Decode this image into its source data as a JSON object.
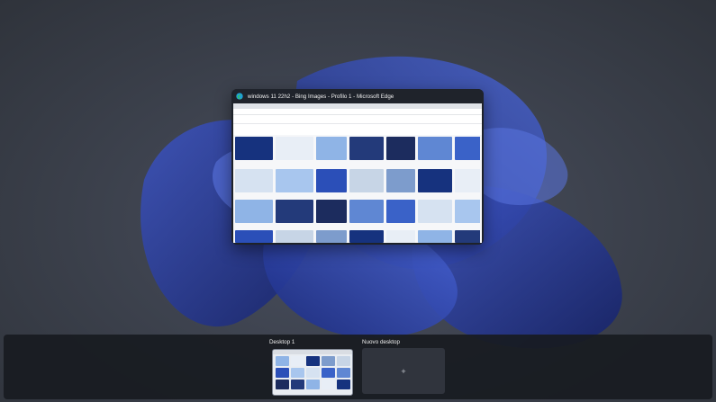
{
  "window": {
    "title": "windows 11 22h2 - Bing Images - Profilo 1 - Microsoft Edge",
    "app_icon": "edge-icon"
  },
  "task_view": {
    "desktops": [
      {
        "label": "Desktop 1"
      },
      {
        "label": "Nuovo desktop",
        "add_symbol": "+"
      }
    ]
  },
  "colors": {
    "panel_bg": "#181b21",
    "wallpaper_accent": "#2a3f9e",
    "window_bg": "#1f232b"
  }
}
